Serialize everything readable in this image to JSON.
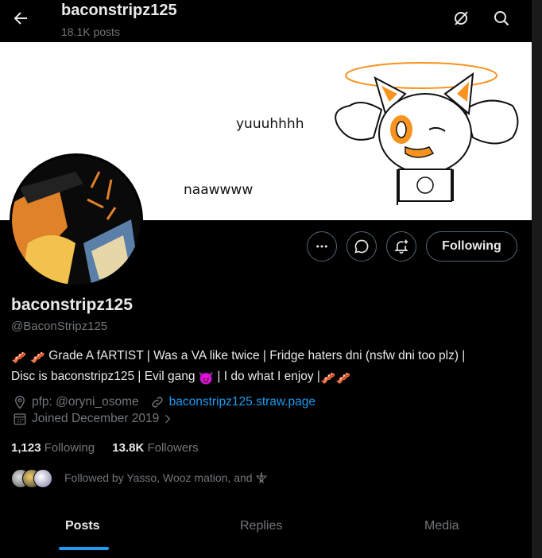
{
  "header": {
    "title": "baconstripz125",
    "post_count": "18.1K posts"
  },
  "banner": {
    "text_1": "yuuuhhhh",
    "text_2": "naawwww"
  },
  "actions": {
    "following_label": "Following"
  },
  "profile": {
    "name": "baconstripz125",
    "handle": "@BaconStripz125",
    "bio_line1": "Grade A fARTIST | Was a VA like twice | Fridge haters dni (nsfw dni too plz) |",
    "bio_line2a": "Disc is baconstripz125 | Evil gang",
    "bio_line2b": "| I do what I enjoy |",
    "pfp_credit": "pfp: @oryni_osome",
    "website": "baconstripz125.straw.page",
    "joined": "Joined December 2019"
  },
  "stats": {
    "following_count": "1,123",
    "following_label": "Following",
    "followers_count": "13.8K",
    "followers_label": "Followers"
  },
  "followed_by": "Followed by Yasso, Wooz mation, and",
  "tabs": [
    "Posts",
    "Replies",
    "Media"
  ],
  "colors": {
    "accent": "#1d9bf0",
    "muted": "#71767b",
    "text": "#e7e9ea"
  }
}
